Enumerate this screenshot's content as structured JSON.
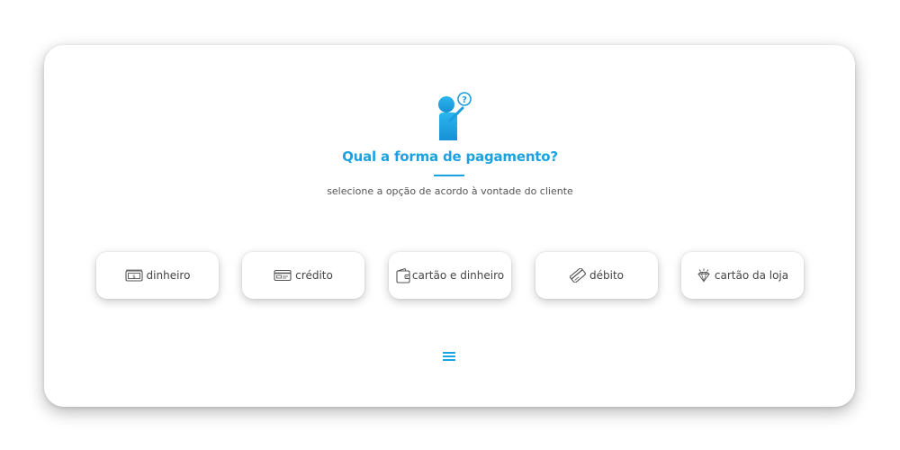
{
  "header": {
    "title": "Qual a forma de pagamento?",
    "subtitle": "selecione a opção de acordo à vontade do cliente",
    "illustration_icon": "person-question-icon"
  },
  "payment_options": [
    {
      "label": "dinheiro",
      "icon": "cash-icon"
    },
    {
      "label": "crédito",
      "icon": "credit-card-icon"
    },
    {
      "label": "cartão e dinheiro",
      "icon": "wallet-icon"
    },
    {
      "label": "débito",
      "icon": "debit-card-icon"
    },
    {
      "label": "cartão da loja",
      "icon": "diamond-icon"
    }
  ],
  "footer": {
    "menu_icon": "hamburger-menu-icon"
  },
  "colors": {
    "accent": "#1aa3e0",
    "text": "#444444",
    "subtitle_text": "#555555",
    "background": "#ffffff"
  }
}
